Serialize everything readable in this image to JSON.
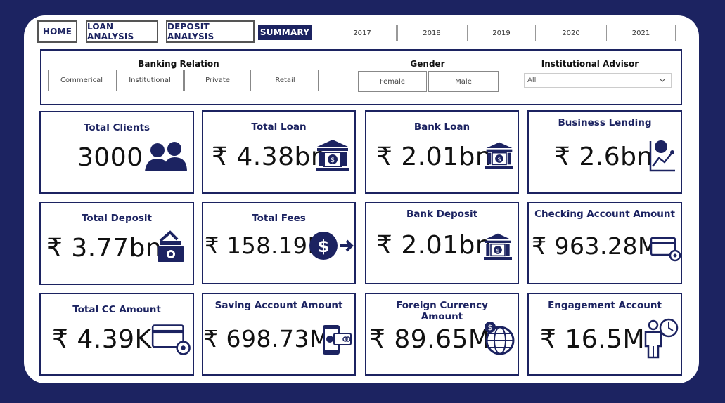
{
  "nav": {
    "home": "HOME",
    "loan_analysis": "LOAN ANALYSIS",
    "deposit_analysis": "DEPOSIT ANALYSIS",
    "summary": "SUMMARY"
  },
  "years": [
    "2017",
    "2018",
    "2019",
    "2020",
    "2021"
  ],
  "filters": {
    "banking_relation": {
      "title": "Banking Relation",
      "options": [
        "Commerical",
        "Institutional",
        "Private",
        "Retail"
      ]
    },
    "gender": {
      "title": "Gender",
      "options": [
        "Female",
        "Male"
      ]
    },
    "institutional_advisor": {
      "title": "Institutional Advisor",
      "selected": "All"
    }
  },
  "kpis": [
    {
      "title": "Total Clients",
      "value": "3000",
      "icon": "clients-icon"
    },
    {
      "title": "Total Loan",
      "value": "₹ 4.38bn",
      "icon": "bank-icon"
    },
    {
      "title": "Bank Loan",
      "value": "₹ 2.01bn",
      "icon": "bank-icon"
    },
    {
      "title": "Business Lending",
      "value": "₹ 2.6bn",
      "icon": "chart-growth-icon"
    },
    {
      "title": "Total Deposit",
      "value": "₹ 3.77bn",
      "icon": "cash-deposit-icon"
    },
    {
      "title": "Total Fees",
      "value": "₹ 158.19M",
      "icon": "dollar-transfer-icon"
    },
    {
      "title": "Bank Deposit",
      "value": "₹ 2.01bn",
      "icon": "bank-icon"
    },
    {
      "title": "Checking Account Amount",
      "value": "₹ 963.28M",
      "icon": "card-settings-icon"
    },
    {
      "title": "Total CC Amount",
      "value": "₹ 4.39K",
      "icon": "card-settings-icon"
    },
    {
      "title": "Saving Account Amount",
      "value": "₹ 698.73M",
      "icon": "mobile-payment-icon"
    },
    {
      "title": "Foreign Currency Amount",
      "value": "₹ 89.65M",
      "icon": "globe-dollar-icon"
    },
    {
      "title": "Engagement Account",
      "value": "₹ 16.5M",
      "icon": "person-clock-icon"
    }
  ],
  "colors": {
    "navy": "#1c2361",
    "background": "#ffffff"
  }
}
